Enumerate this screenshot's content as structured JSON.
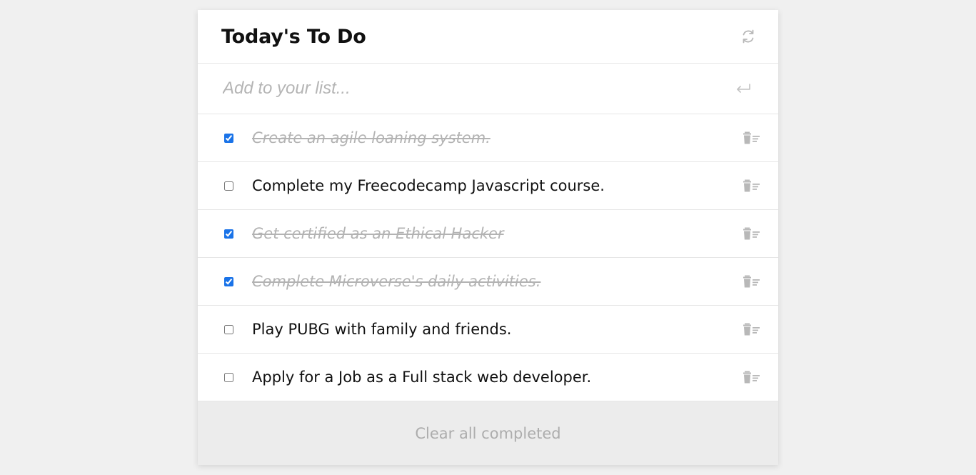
{
  "header": {
    "title": "Today's To Do",
    "refresh_icon": "refresh-icon"
  },
  "add": {
    "placeholder": "Add to your list...",
    "value": "",
    "enter_icon": "enter-icon"
  },
  "tasks": [
    {
      "text": "Create an agile loaning system.",
      "completed": true
    },
    {
      "text": "Complete my Freecodecamp Javascript course.",
      "completed": false
    },
    {
      "text": "Get certified as an Ethical Hacker",
      "completed": true
    },
    {
      "text": "Complete Microverse's daily activities.",
      "completed": true
    },
    {
      "text": "Play PUBG with family and friends.",
      "completed": false
    },
    {
      "text": "Apply for a Job as a Full stack web developer.",
      "completed": false
    }
  ],
  "footer": {
    "clear_label": "Clear all completed"
  },
  "colors": {
    "background": "#f0f0f0",
    "card": "#ffffff",
    "footer": "#ececec",
    "completed_text": "#b3b3b3",
    "checkbox_accent": "#1a73e8",
    "icon_gray": "#b8b8b8"
  }
}
